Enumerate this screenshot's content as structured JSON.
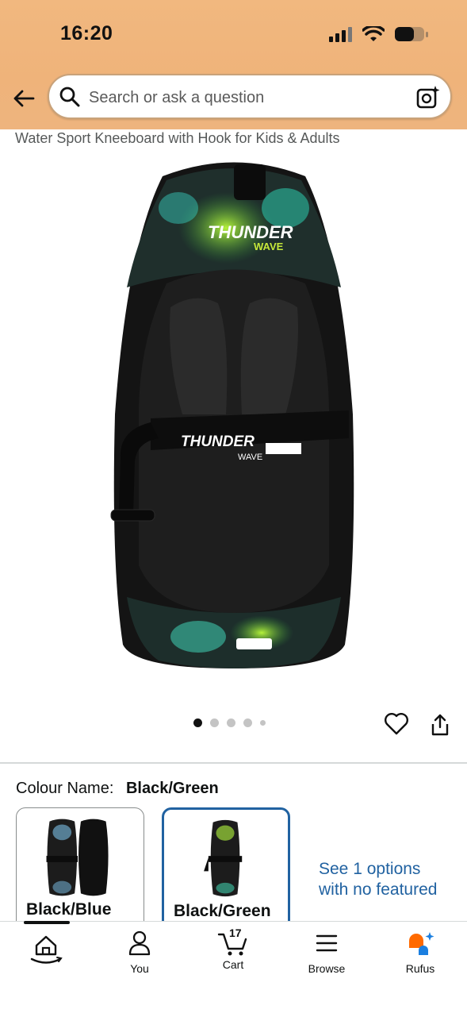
{
  "status": {
    "time": "16:20"
  },
  "search": {
    "placeholder": "Search or ask a question"
  },
  "product": {
    "title": "Water Sport Kneeboard with Hook for Kids & Adults"
  },
  "colour": {
    "label": "Colour Name:",
    "selected": "Black/Green",
    "options": [
      {
        "name": "Black/Blue"
      },
      {
        "name": "Black/Green"
      }
    ],
    "see_more": "See 1 options with no featured"
  },
  "nav": {
    "home": "",
    "you": "You",
    "cart": "Cart",
    "cart_count": "17",
    "browse": "Browse",
    "rufus": "Rufus"
  },
  "colors": {
    "link": "#2162a1",
    "header": "#f1b87f",
    "rufus": "#ff6a00"
  },
  "carousel": {
    "count": 5,
    "active": 1
  }
}
